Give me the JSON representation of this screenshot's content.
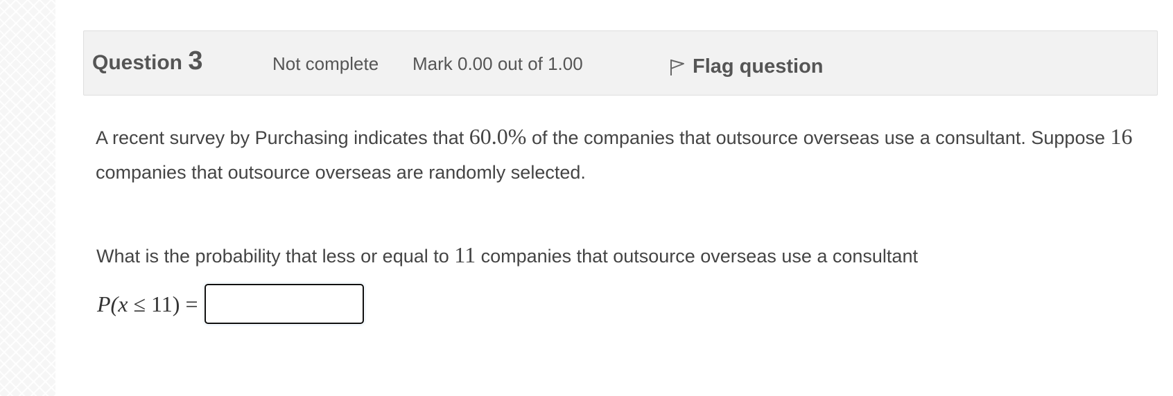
{
  "question": {
    "label": "Question",
    "number": "3",
    "state": "Not complete",
    "grade": "Mark 0.00 out of 1.00",
    "flag_label": "Flag question"
  },
  "text": {
    "part1": "A recent survey by Purchasing indicates that ",
    "percent": "60.0%",
    "part2": " of the companies that outsource overseas use a consultant. Suppose ",
    "n": "16",
    "part3": " companies that outsource overseas are randomly selected."
  },
  "prompt": {
    "part1": "What is the probability that less or equal to ",
    "k": "11",
    "part2": " companies that outsource overseas use a consultant"
  },
  "answer": {
    "expr_prefix": "P(",
    "variable": "x",
    "expr_rest": " ≤ 11) =",
    "value": ""
  },
  "colors": {
    "header_bg": "#f2f2f2",
    "input_border": "#6fa8e8"
  }
}
